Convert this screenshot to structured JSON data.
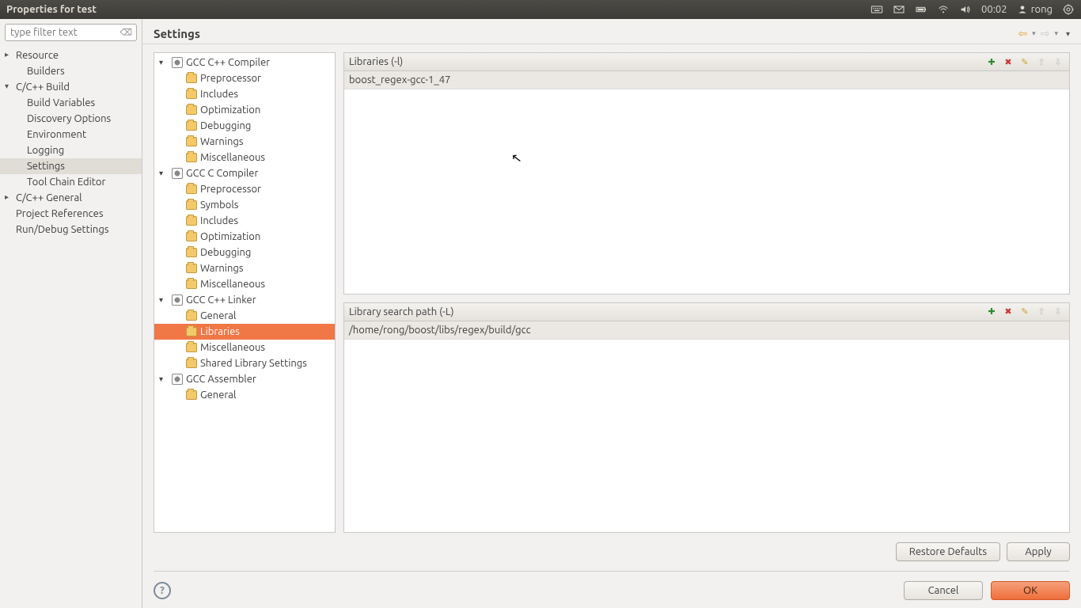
{
  "topbar": {
    "title": "Properties for test",
    "time": "00:02",
    "user": "rong"
  },
  "sidebar": {
    "filter_placeholder": "type filter text",
    "items": [
      {
        "label": "Resource",
        "cls": "tree-item expandable"
      },
      {
        "label": "Builders",
        "cls": "tree-item level1"
      },
      {
        "label": "C/C++ Build",
        "cls": "tree-item expandable expanded"
      },
      {
        "label": "Build Variables",
        "cls": "tree-item level1"
      },
      {
        "label": "Discovery Options",
        "cls": "tree-item level1"
      },
      {
        "label": "Environment",
        "cls": "tree-item level1"
      },
      {
        "label": "Logging",
        "cls": "tree-item level1"
      },
      {
        "label": "Settings",
        "cls": "tree-item level1 selected"
      },
      {
        "label": "Tool Chain Editor",
        "cls": "tree-item level1"
      },
      {
        "label": "C/C++ General",
        "cls": "tree-item expandable"
      },
      {
        "label": "Project References",
        "cls": "tree-item"
      },
      {
        "label": "Run/Debug Settings",
        "cls": "tree-item"
      }
    ]
  },
  "main": {
    "title": "Settings"
  },
  "tool_tree": [
    {
      "label": "GCC C++ Compiler",
      "cls": "tt-item lvl0",
      "arrow": "▾",
      "icon": "gear"
    },
    {
      "label": "Preprocessor",
      "cls": "tt-item lvl1",
      "icon": "folder"
    },
    {
      "label": "Includes",
      "cls": "tt-item lvl1",
      "icon": "folder"
    },
    {
      "label": "Optimization",
      "cls": "tt-item lvl1",
      "icon": "folder"
    },
    {
      "label": "Debugging",
      "cls": "tt-item lvl1",
      "icon": "folder"
    },
    {
      "label": "Warnings",
      "cls": "tt-item lvl1",
      "icon": "folder"
    },
    {
      "label": "Miscellaneous",
      "cls": "tt-item lvl1",
      "icon": "folder"
    },
    {
      "label": "GCC C Compiler",
      "cls": "tt-item lvl0",
      "arrow": "▾",
      "icon": "gear"
    },
    {
      "label": "Preprocessor",
      "cls": "tt-item lvl1",
      "icon": "folder"
    },
    {
      "label": "Symbols",
      "cls": "tt-item lvl1",
      "icon": "folder"
    },
    {
      "label": "Includes",
      "cls": "tt-item lvl1",
      "icon": "folder"
    },
    {
      "label": "Optimization",
      "cls": "tt-item lvl1",
      "icon": "folder"
    },
    {
      "label": "Debugging",
      "cls": "tt-item lvl1",
      "icon": "folder"
    },
    {
      "label": "Warnings",
      "cls": "tt-item lvl1",
      "icon": "folder"
    },
    {
      "label": "Miscellaneous",
      "cls": "tt-item lvl1",
      "icon": "folder"
    },
    {
      "label": "GCC C++ Linker",
      "cls": "tt-item lvl0",
      "arrow": "▾",
      "icon": "gear"
    },
    {
      "label": "General",
      "cls": "tt-item lvl1",
      "icon": "folder"
    },
    {
      "label": "Libraries",
      "cls": "tt-item lvl1 selected",
      "icon": "folder"
    },
    {
      "label": "Miscellaneous",
      "cls": "tt-item lvl1",
      "icon": "folder"
    },
    {
      "label": "Shared Library Settings",
      "cls": "tt-item lvl1",
      "icon": "folder"
    },
    {
      "label": "GCC Assembler",
      "cls": "tt-item lvl0",
      "arrow": "▾",
      "icon": "gear"
    },
    {
      "label": "General",
      "cls": "tt-item lvl1",
      "icon": "folder"
    }
  ],
  "panels": {
    "libraries": {
      "title": "Libraries (-l)",
      "items": [
        "boost_regex-gcc-1_47"
      ]
    },
    "search_path": {
      "title": "Library search path (-L)",
      "items": [
        "/home/rong/boost/libs/regex/build/gcc"
      ]
    }
  },
  "buttons": {
    "restore": "Restore Defaults",
    "apply": "Apply",
    "cancel": "Cancel",
    "ok": "OK"
  }
}
